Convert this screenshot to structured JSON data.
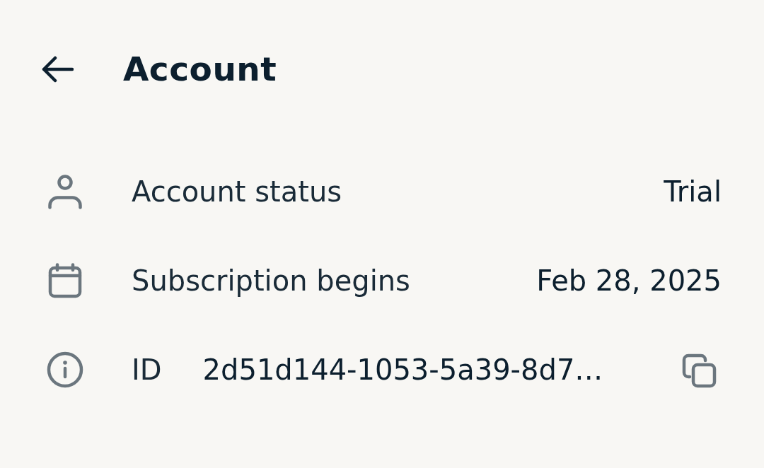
{
  "header": {
    "title": "Account"
  },
  "rows": [
    {
      "kind": "value",
      "label": "Account status",
      "value": "Trial"
    },
    {
      "kind": "value",
      "label": "Subscription begins",
      "value": "Feb 28, 2025"
    },
    {
      "kind": "copy",
      "label": "ID",
      "value": "2d51d144-1053-5a39-8d7…"
    }
  ]
}
